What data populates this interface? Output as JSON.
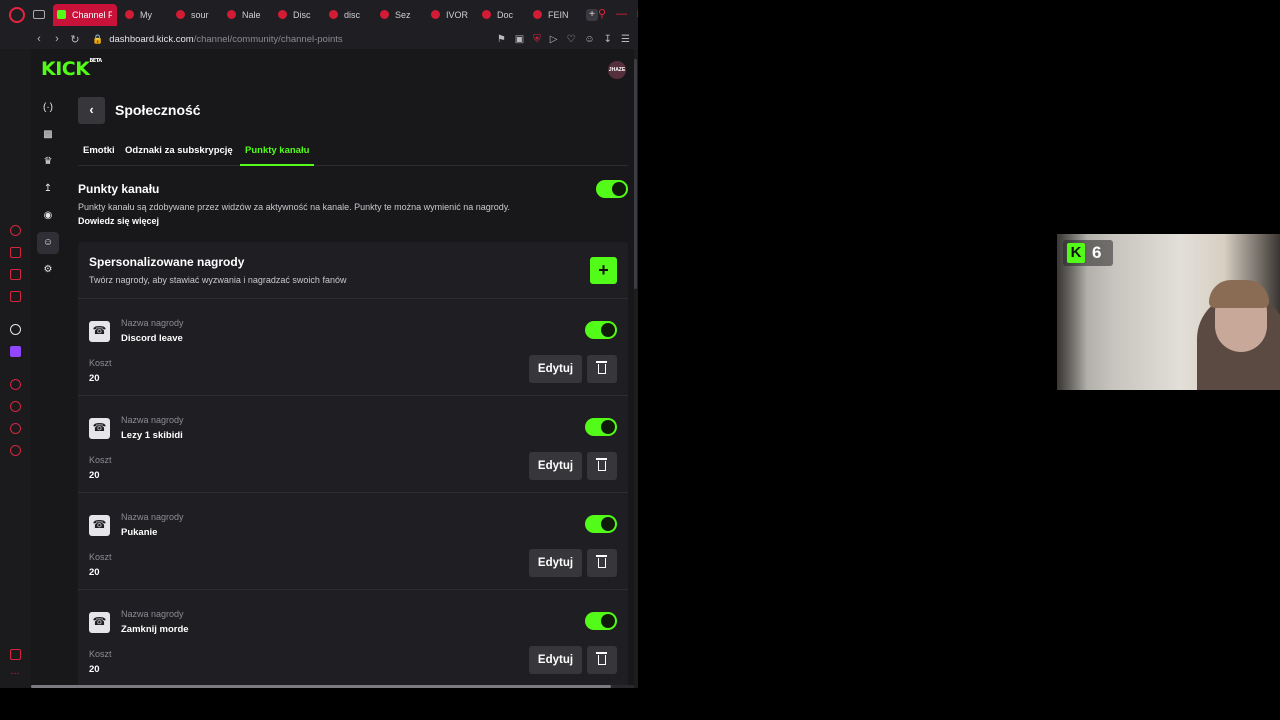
{
  "browser": {
    "tabs": [
      {
        "label": "Channel P",
        "active": true
      },
      {
        "label": "My"
      },
      {
        "label": "sour"
      },
      {
        "label": "Nale"
      },
      {
        "label": "Disc"
      },
      {
        "label": "disc"
      },
      {
        "label": "Sez"
      },
      {
        "label": "IVOR"
      },
      {
        "label": "Doc"
      },
      {
        "label": "FEIN"
      }
    ],
    "url_host": "dashboard.kick.com",
    "url_path": "/channel/community/channel-points",
    "accent": "#e8233f"
  },
  "kick": {
    "logo": "KICK",
    "logo_badge": "BETA",
    "avatar_text": "JHAZE",
    "page_title": "Społeczność",
    "tabs": [
      {
        "label": "Emotki"
      },
      {
        "label": "Odznaki za subskrypcję"
      },
      {
        "label": "Punkty kanału",
        "active": true
      }
    ],
    "section": {
      "title": "Punkty kanału",
      "description": "Punkty kanału są zdobywane przez widzów za aktywność na kanale. Punkty te można wymienić na nagrody.",
      "link": "Dowiedz się więcej",
      "enabled": true
    },
    "custom_rewards": {
      "title": "Spersonalizowane nagrody",
      "description": "Twórz nagrody, aby stawiać wyzwania i nagradzać swoich fanów",
      "add_label": "+",
      "name_label": "Nazwa nagrody",
      "cost_label": "Koszt",
      "edit_label": "Edytuj",
      "items": [
        {
          "name": "Discord leave",
          "cost": "20",
          "enabled": true
        },
        {
          "name": "Lezy 1 skibidi",
          "cost": "20",
          "enabled": true
        },
        {
          "name": "Pukanie",
          "cost": "20",
          "enabled": true
        },
        {
          "name": "Zamknij morde",
          "cost": "20",
          "enabled": true
        }
      ]
    },
    "accent": "#53fc18"
  },
  "webcam": {
    "badge_letter": "K",
    "badge_count": "6"
  }
}
